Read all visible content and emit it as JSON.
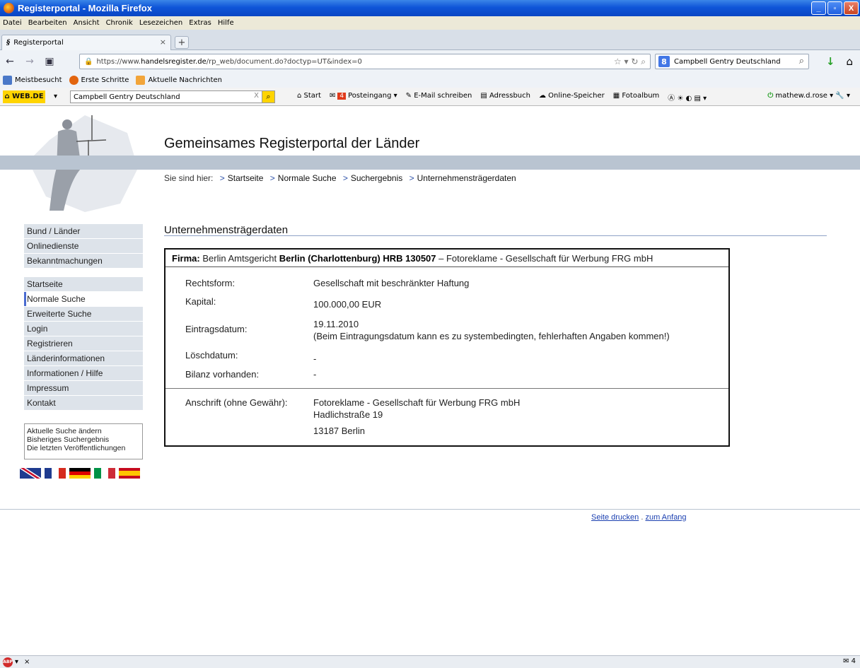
{
  "window": {
    "title": "Registerportal - Mozilla Firefox",
    "min": "_",
    "max": "▫",
    "close": "X"
  },
  "menu": [
    "Datei",
    "Bearbeiten",
    "Ansicht",
    "Chronik",
    "Lesezeichen",
    "Extras",
    "Hilfe"
  ],
  "tab": {
    "label": "Registerportal",
    "favicon": "§",
    "close": "×",
    "new": "+"
  },
  "nav": {
    "url_prefix": "https://www.",
    "url_domain": "handelsregister.de",
    "url_path": "/rp_web/document.do?doctyp=UT&index=0",
    "search_engine": "8",
    "search_value": "Campbell Gentry Deutschland"
  },
  "bookmarks": [
    {
      "label": "Meistbesucht",
      "color": "#4a78c8"
    },
    {
      "label": "Erste Schritte",
      "color": "#e2650f"
    },
    {
      "label": "Aktuelle Nachrichten",
      "color": "#f2a53a"
    }
  ],
  "webde": {
    "logo": "WEB.DE",
    "search_value": "Campbell Gentry Deutschland",
    "clear": "X",
    "links": [
      "Start",
      "Posteingang",
      "E-Mail schreiben",
      "Adressbuch",
      "Online-Speicher",
      "Fotoalbum"
    ],
    "inbox_count": "4",
    "user": "mathew.d.rose"
  },
  "page": {
    "portal_title": "Gemeinsames Registerportal der Länder",
    "breadcrumb": {
      "lead": "Sie sind hier:",
      "items": [
        "Startseite",
        "Normale Suche",
        "Suchergebnis",
        "Unternehmensträgerdaten"
      ]
    },
    "nav_group1": [
      "Bund / Länder",
      "Onlinedienste",
      "Bekanntmachungen"
    ],
    "nav_group2": [
      "Startseite",
      "Normale Suche",
      "Erweiterte Suche",
      "Login",
      "Registrieren",
      "Länderinformationen",
      "Informationen / Hilfe",
      "Impressum",
      "Kontakt"
    ],
    "active_nav": "Normale Suche",
    "sidebox": [
      "Aktuelle Suche ändern",
      "Bisheriges Suchergebnis",
      "Die letzten Veröffentlichungen"
    ],
    "section_title": "Unternehmensträgerdaten",
    "record": {
      "firma_label": "Firma:",
      "court_prefix": "Berlin Amtsgericht",
      "court_bold": "Berlin (Charlottenburg) HRB 130507",
      "company_suffix": "– Fotoreklame - Gesellschaft für Werbung FRG mbH",
      "rechtsform_label": "Rechtsform:",
      "rechtsform_value": "Gesellschaft mit beschränkter Haftung",
      "kapital_label": "Kapital:",
      "kapital_value": "100.000,00 EUR",
      "eintrag_label": "Eintragsdatum:",
      "eintrag_value": "19.11.2010",
      "eintrag_note": "(Beim Eintragungsdatum kann es zu systembedingten, fehlerhaften Angaben kommen!)",
      "loesch_label": "Löschdatum:",
      "loesch_value": "-",
      "bilanz_label": "Bilanz vorhanden:",
      "bilanz_value": "-",
      "anschrift_label": "Anschrift (ohne Gewähr):",
      "anschrift_line1": "Fotoreklame - Gesellschaft für Werbung FRG mbH",
      "anschrift_line2": "Hadlichstraße 19",
      "anschrift_line3": "13187 Berlin"
    },
    "footer": {
      "print": "Seite drucken",
      "sep": ".",
      "top": "zum Anfang"
    }
  },
  "status": {
    "abp": "ABP",
    "close": "×",
    "mail_count": "4"
  },
  "colors": {
    "accent": "#4a6bd1",
    "band": "#b9c4d1",
    "nav_bg": "#dde3ea"
  }
}
